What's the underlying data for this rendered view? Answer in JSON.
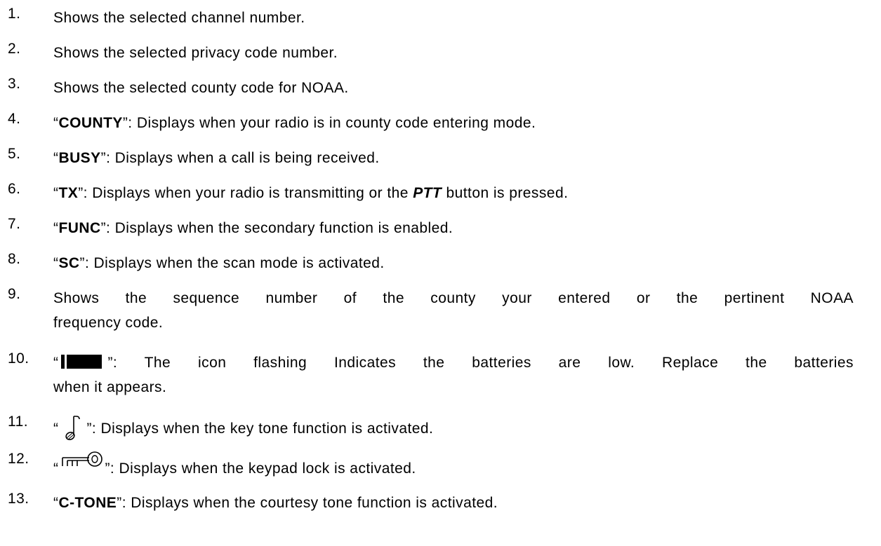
{
  "items": [
    {
      "num": "1.",
      "text": "Shows the selected channel number."
    },
    {
      "num": "2.",
      "text": "Shows the selected privacy code number."
    },
    {
      "num": "3.",
      "text": "Shows the selected county code for NOAA."
    },
    {
      "num": "4.",
      "term": "COUNTY",
      "desc": ":  Displays when your radio is in county code entering mode."
    },
    {
      "num": "5.",
      "term": "BUSY",
      "desc": ":  Displays when a call is being received."
    },
    {
      "num": "6.",
      "term": "TX",
      "desc_a": ":  Displays when your radio is transmitting or the ",
      "emph": "PTT",
      "desc_b": " button is pressed."
    },
    {
      "num": "7.",
      "term": "FUNC",
      "desc": ":  Displays when the secondary function is enabled."
    },
    {
      "num": "8.",
      "term": "SC",
      "desc": ":  Displays when the scan mode is activated."
    },
    {
      "num": "9.",
      "line1": "Shows  the  sequence  number  of  the  county  your  entered  or  the  pertinent  NOAA",
      "line2": "frequency code."
    },
    {
      "num": "10.",
      "icon": "battery-low-icon",
      "line1": ": The icon flashing Indicates the batteries are low.  Replace the batteries",
      "line2": "when it appears."
    },
    {
      "num": "11.",
      "icon": "music-note-icon",
      "desc": ":    Displays when the key tone function is activated."
    },
    {
      "num": "12.",
      "icon": "key-icon",
      "desc": ":  Displays when the keypad lock is activated."
    },
    {
      "num": "13.",
      "term": "C-TONE",
      "desc": ":  Displays when the courtesy tone function is activated."
    }
  ],
  "quote_open": "“",
  "quote_close": "”",
  "colors": {
    "text": "#000000",
    "background": "#ffffff"
  }
}
